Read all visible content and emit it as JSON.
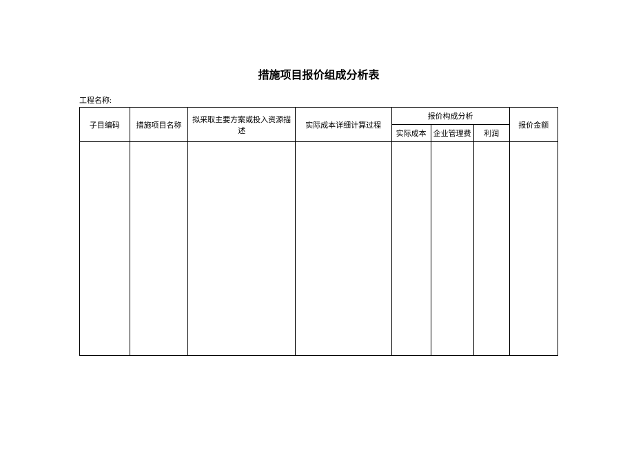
{
  "title": "措施项目报价组成分析表",
  "project_label": "工程名称:",
  "headers": {
    "col1": "子目编码",
    "col2": "措施项目名称",
    "col3": "拟采取主要方案或投入资源描述",
    "col4": "实际成本详细计算过程",
    "group": "报价构成分析",
    "sub1": "实际成本",
    "sub2": "企业管理费",
    "sub3": "利润",
    "col8": "报价金额"
  },
  "rows": [
    {
      "c1": "",
      "c2": "",
      "c3": "",
      "c4": "",
      "c5": "",
      "c6": "",
      "c7": "",
      "c8": ""
    }
  ]
}
